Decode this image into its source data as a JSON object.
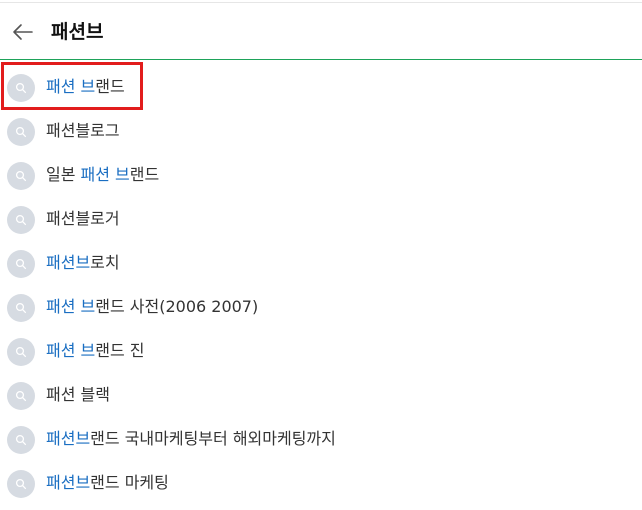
{
  "search": {
    "query": "패션브"
  },
  "suggestions": [
    {
      "parts": [
        {
          "text": "패션 브",
          "hl": true
        },
        {
          "text": "랜드",
          "hl": false
        }
      ]
    },
    {
      "parts": [
        {
          "text": "패션블로그",
          "hl": false
        }
      ]
    },
    {
      "parts": [
        {
          "text": "일본 ",
          "hl": false
        },
        {
          "text": "패션 브",
          "hl": true
        },
        {
          "text": "랜드",
          "hl": false
        }
      ]
    },
    {
      "parts": [
        {
          "text": "패션블로거",
          "hl": false
        }
      ]
    },
    {
      "parts": [
        {
          "text": "패션브",
          "hl": true
        },
        {
          "text": "로치",
          "hl": false
        }
      ]
    },
    {
      "parts": [
        {
          "text": "패션 브",
          "hl": true
        },
        {
          "text": "랜드 사전(2006 2007)",
          "hl": false
        }
      ]
    },
    {
      "parts": [
        {
          "text": "패션 브",
          "hl": true
        },
        {
          "text": "랜드 진",
          "hl": false
        }
      ]
    },
    {
      "parts": [
        {
          "text": "패션 블랙",
          "hl": false
        }
      ]
    },
    {
      "parts": [
        {
          "text": "패션브",
          "hl": true
        },
        {
          "text": "랜드 국내마케팅부터 해외마케팅까지",
          "hl": false
        }
      ]
    },
    {
      "parts": [
        {
          "text": "패션브",
          "hl": true
        },
        {
          "text": "랜드 마케팅",
          "hl": false
        }
      ]
    }
  ],
  "selected_index": 0,
  "icons": {
    "back": "arrow-left-icon",
    "suggestion": "search-icon"
  },
  "colors": {
    "highlight": "#1a6ec2",
    "header_underline": "#1ea35a",
    "selection_box": "#e21c1c",
    "icon_circle": "#d6dbe2"
  }
}
